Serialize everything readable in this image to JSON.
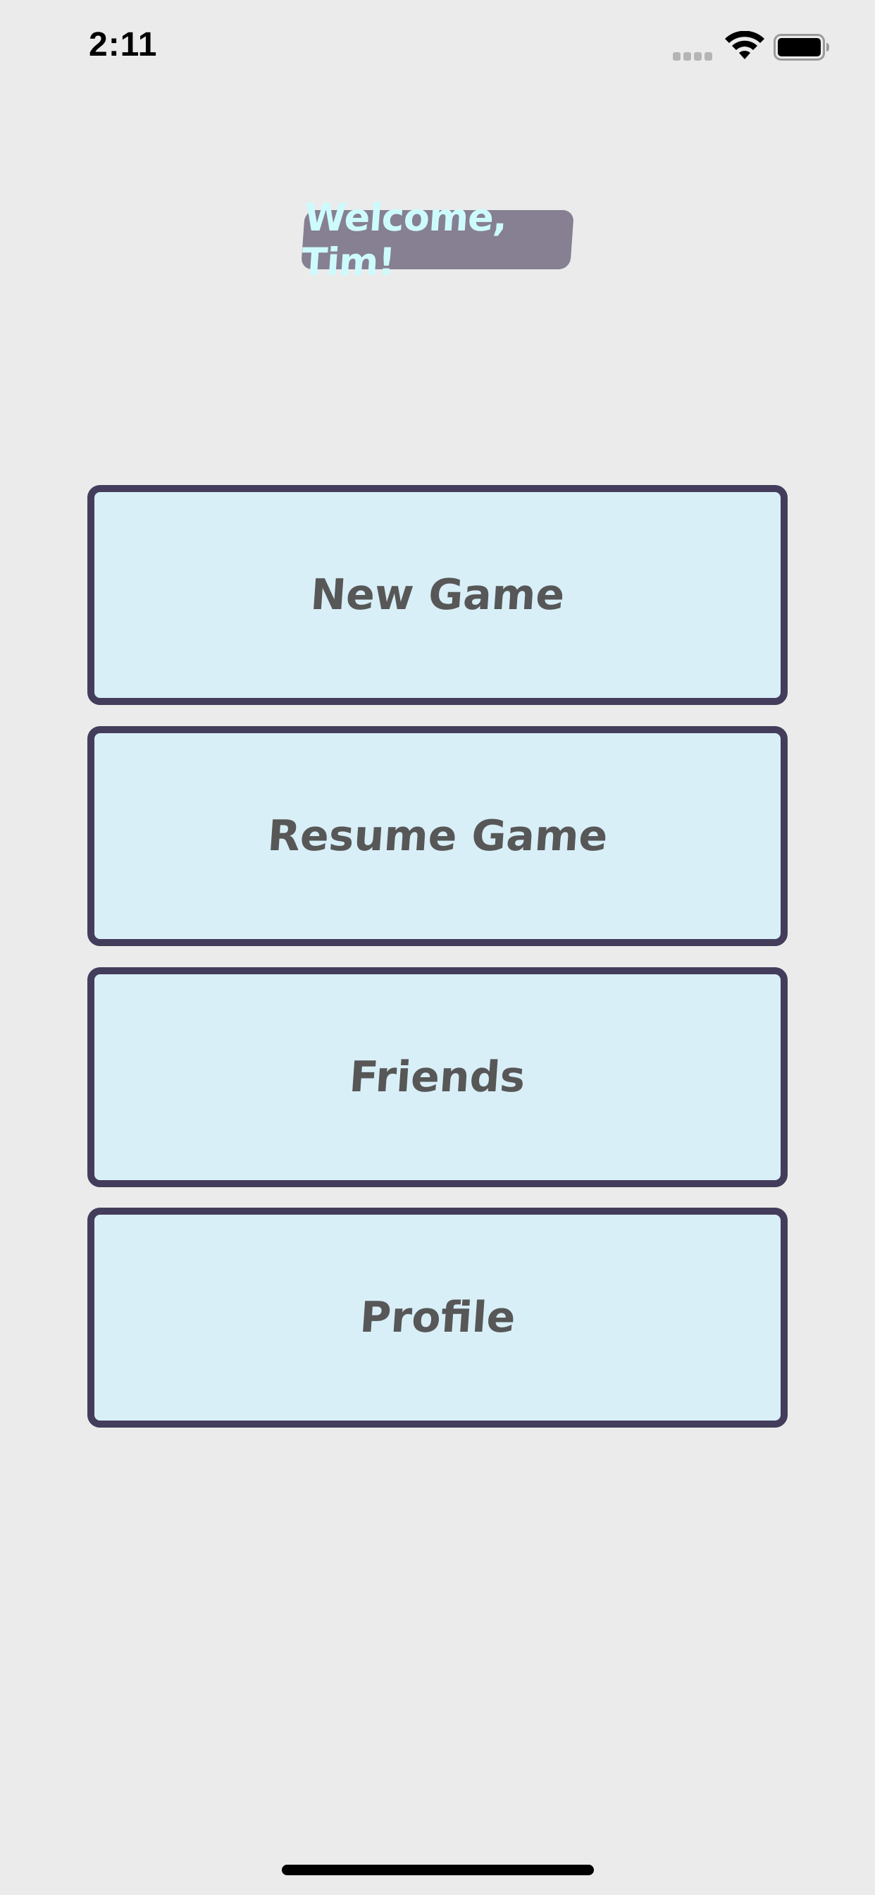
{
  "status_bar": {
    "time": "2:11",
    "icons": [
      "cellular-signal-icon",
      "wifi-icon",
      "battery-icon"
    ]
  },
  "welcome": {
    "text": "Welcome, Tim!"
  },
  "menu": {
    "items": [
      {
        "label": "New Game"
      },
      {
        "label": "Resume Game"
      },
      {
        "label": "Friends"
      },
      {
        "label": "Profile"
      }
    ]
  },
  "colors": {
    "background": "#ebebeb",
    "button_fill": "#d9eff8",
    "button_border": "#433d5b",
    "button_text": "#575757",
    "badge_fill": "#868092",
    "badge_text": "#cdfbfd"
  }
}
